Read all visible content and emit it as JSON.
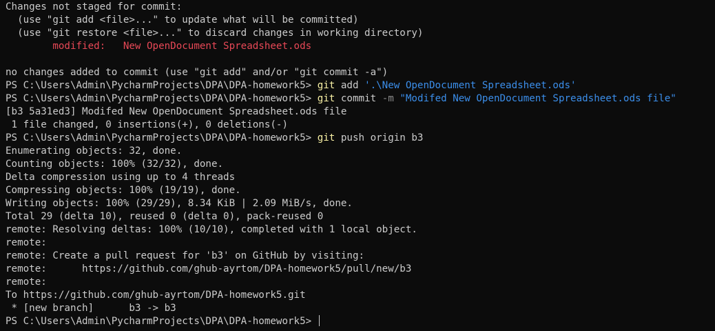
{
  "terminal": {
    "colors": {
      "background": "#0c0c0c",
      "default": "#cccccc",
      "yellow": "#f9f1a5",
      "blue": "#3b8eea",
      "red": "#e74856",
      "gray": "#8a8a8a",
      "cursor": "#cccccc"
    },
    "lines": [
      [
        {
          "text": "Changes not staged for commit:",
          "color": "default"
        }
      ],
      [
        {
          "text": "  (use \"git add <file>...\" to update what will be committed)",
          "color": "default"
        }
      ],
      [
        {
          "text": "  (use \"git restore <file>...\" to discard changes in working directory)",
          "color": "default"
        }
      ],
      [
        {
          "text": "\tmodified:   New OpenDocument Spreadsheet.ods",
          "color": "red"
        }
      ],
      [
        {
          "text": "",
          "color": "default"
        }
      ],
      [
        {
          "text": "no changes added to commit (use \"git add\" and/or \"git commit -a\")",
          "color": "default"
        }
      ],
      [
        {
          "text": "PS C:\\Users\\Admin\\PycharmProjects\\DPA\\DPA-homework5> ",
          "color": "default"
        },
        {
          "text": "git",
          "color": "yellow"
        },
        {
          "text": " add ",
          "color": "default"
        },
        {
          "text": "'.\\New OpenDocument Spreadsheet.ods'",
          "color": "blue"
        }
      ],
      [
        {
          "text": "PS C:\\Users\\Admin\\PycharmProjects\\DPA\\DPA-homework5> ",
          "color": "default"
        },
        {
          "text": "git",
          "color": "yellow"
        },
        {
          "text": " commit ",
          "color": "default"
        },
        {
          "text": "-m",
          "color": "gray"
        },
        {
          "text": " ",
          "color": "default"
        },
        {
          "text": "\"Modifed New OpenDocument Spreadsheet.ods file\"",
          "color": "blue"
        }
      ],
      [
        {
          "text": "[b3 5a31ed3] Modifed New OpenDocument Spreadsheet.ods file",
          "color": "default"
        }
      ],
      [
        {
          "text": " 1 file changed, 0 insertions(+), 0 deletions(-)",
          "color": "default"
        }
      ],
      [
        {
          "text": "PS C:\\Users\\Admin\\PycharmProjects\\DPA\\DPA-homework5> ",
          "color": "default"
        },
        {
          "text": "git",
          "color": "yellow"
        },
        {
          "text": " push origin b3",
          "color": "default"
        }
      ],
      [
        {
          "text": "Enumerating objects: 32, done.",
          "color": "default"
        }
      ],
      [
        {
          "text": "Counting objects: 100% (32/32), done.",
          "color": "default"
        }
      ],
      [
        {
          "text": "Delta compression using up to 4 threads",
          "color": "default"
        }
      ],
      [
        {
          "text": "Compressing objects: 100% (19/19), done.",
          "color": "default"
        }
      ],
      [
        {
          "text": "Writing objects: 100% (29/29), 8.34 KiB | 2.09 MiB/s, done.",
          "color": "default"
        }
      ],
      [
        {
          "text": "Total 29 (delta 10), reused 0 (delta 0), pack-reused 0",
          "color": "default"
        }
      ],
      [
        {
          "text": "remote: Resolving deltas: 100% (10/10), completed with 1 local object.",
          "color": "default"
        }
      ],
      [
        {
          "text": "remote:",
          "color": "default"
        }
      ],
      [
        {
          "text": "remote: Create a pull request for 'b3' on GitHub by visiting:",
          "color": "default"
        }
      ],
      [
        {
          "text": "remote:      https://github.com/ghub-ayrtom/DPA-homework5/pull/new/b3",
          "color": "default"
        }
      ],
      [
        {
          "text": "remote:",
          "color": "default"
        }
      ],
      [
        {
          "text": "To https://github.com/ghub-ayrtom/DPA-homework5.git",
          "color": "default"
        }
      ],
      [
        {
          "text": " * [new branch]      b3 -> b3",
          "color": "default"
        }
      ],
      [
        {
          "text": "PS C:\\Users\\Admin\\PycharmProjects\\DPA\\DPA-homework5> ",
          "color": "default"
        }
      ]
    ]
  }
}
